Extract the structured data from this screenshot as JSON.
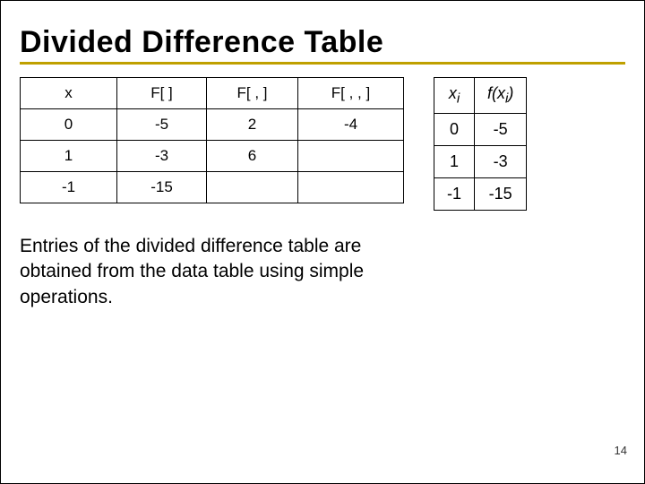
{
  "title": "Divided Difference Table",
  "main_table": {
    "headers": [
      "x",
      "F[  ]",
      "F[  ,  ]",
      "F[  ,  ,  ]"
    ],
    "rows": [
      [
        "0",
        "-5",
        "2",
        "-4"
      ],
      [
        "1",
        "-3",
        "6",
        ""
      ],
      [
        "-1",
        "-15",
        "",
        ""
      ]
    ]
  },
  "side_table": {
    "h1_html": "x<sub>i</sub>",
    "h2_html": "f(x<sub>i</sub>)",
    "rows": [
      [
        "0",
        "-5"
      ],
      [
        "1",
        "-3"
      ],
      [
        "-1",
        "-15"
      ]
    ]
  },
  "description": "Entries of the divided difference table are obtained from the data table using simple operations.",
  "page_number": "14",
  "chart_data": [
    {
      "type": "table",
      "title": "Divided Difference Table",
      "columns": [
        "x",
        "F[ ]",
        "F[ , ]",
        "F[ , , ]"
      ],
      "rows": [
        {
          "x": 0,
          "F[ ]": -5,
          "F[ , ]": 2,
          "F[ , , ]": -4
        },
        {
          "x": 1,
          "F[ ]": -3,
          "F[ , ]": 6,
          "F[ , , ]": null
        },
        {
          "x": -1,
          "F[ ]": -15,
          "F[ , ]": null,
          "F[ , , ]": null
        }
      ]
    },
    {
      "type": "table",
      "title": "Data points",
      "columns": [
        "x_i",
        "f(x_i)"
      ],
      "rows": [
        {
          "x_i": 0,
          "f(x_i)": -5
        },
        {
          "x_i": 1,
          "f(x_i)": -3
        },
        {
          "x_i": -1,
          "f(x_i)": -15
        }
      ]
    }
  ]
}
